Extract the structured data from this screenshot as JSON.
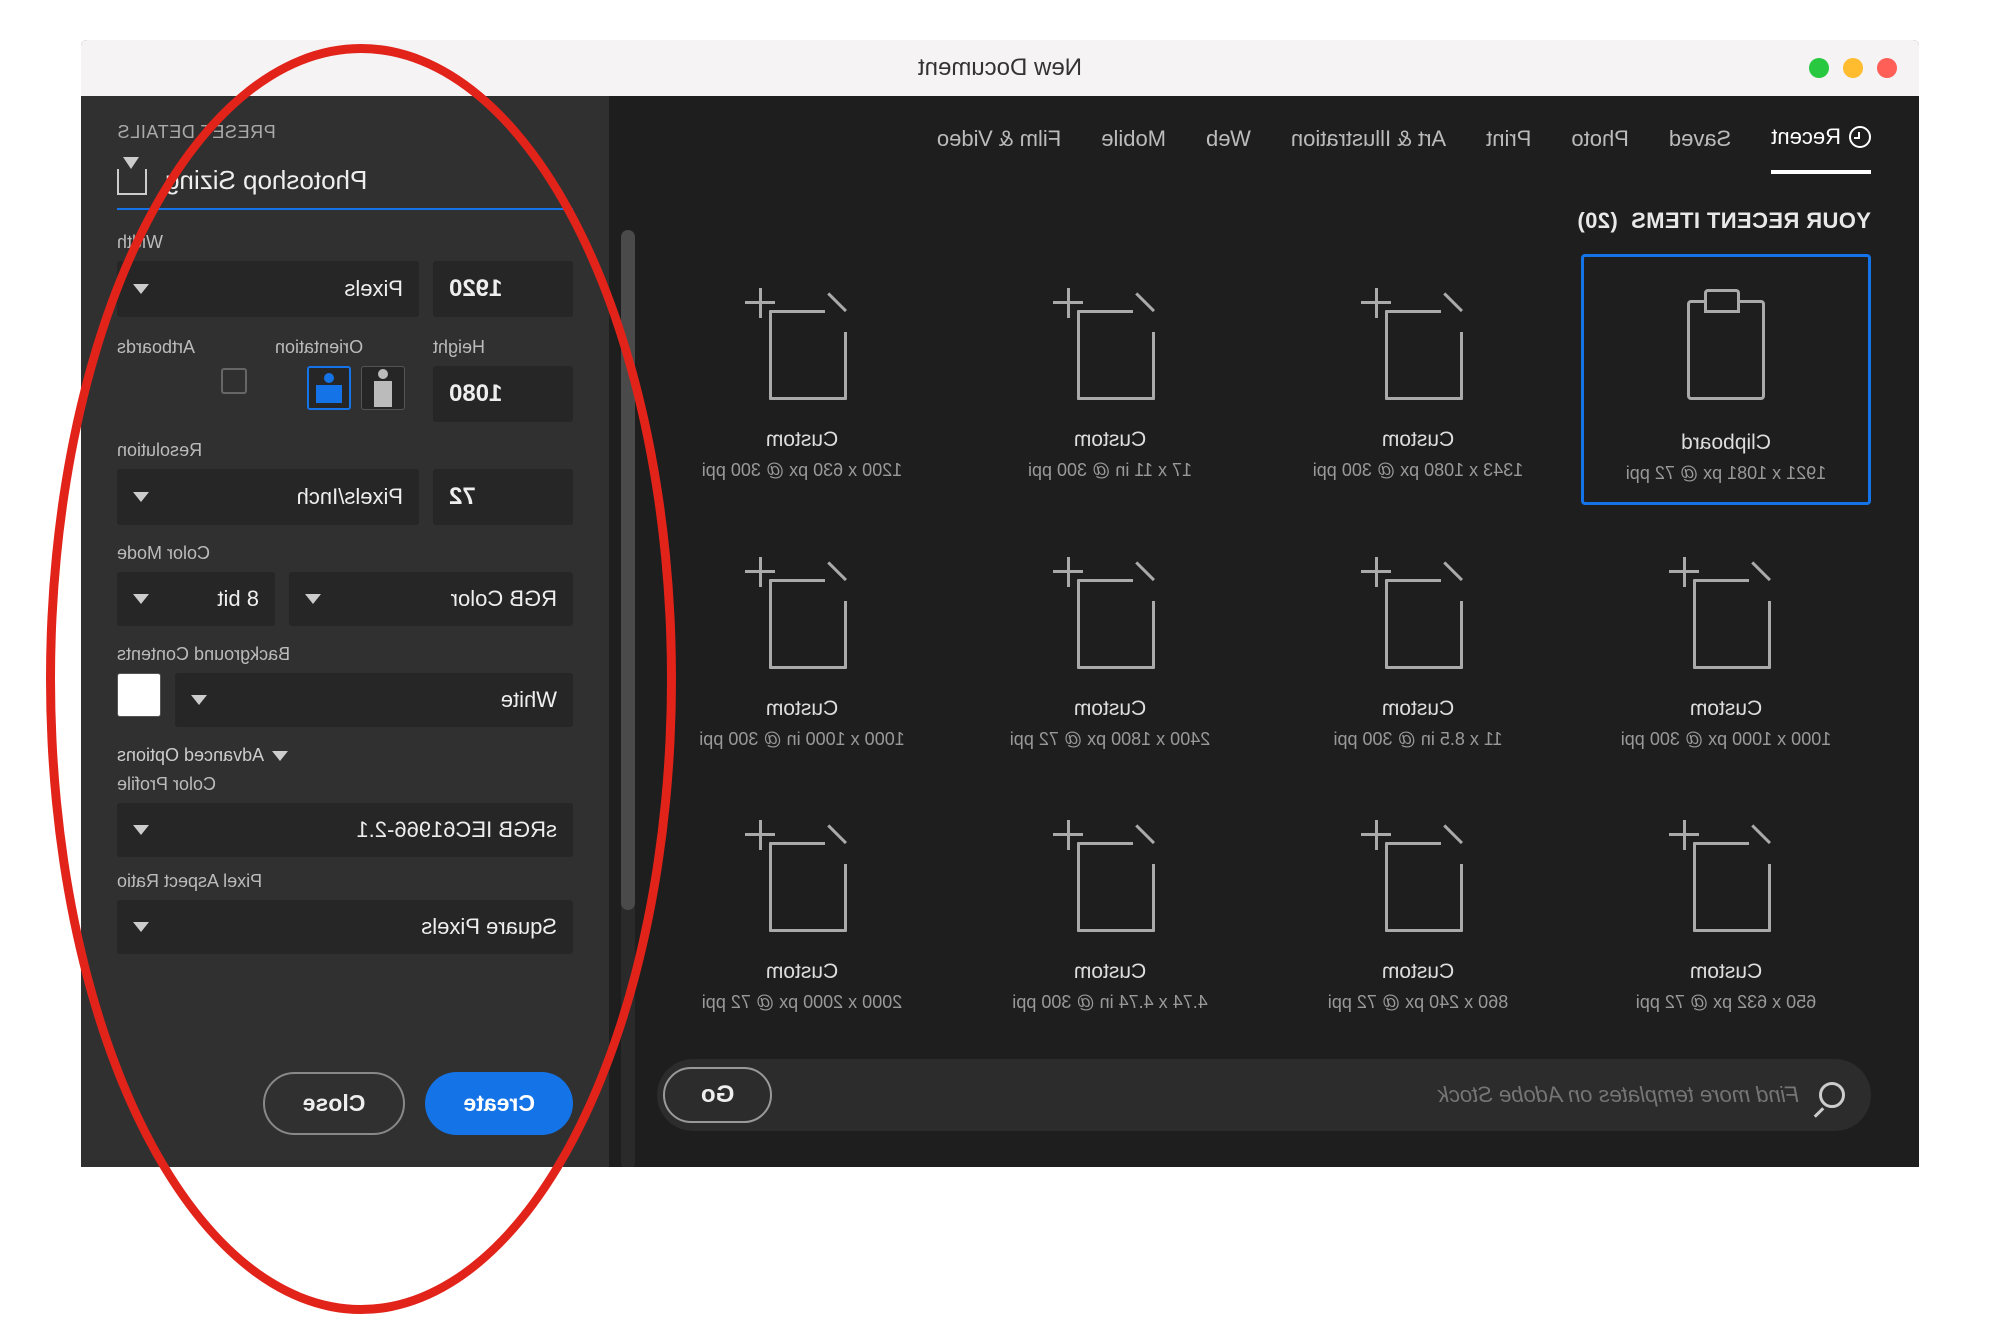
{
  "window_title": "New Document",
  "tabs": [
    "Recent",
    "Saved",
    "Photo",
    "Print",
    "Art & Illustration",
    "Web",
    "Mobile",
    "Film & Video"
  ],
  "active_tab": 0,
  "recent_header": "YOUR RECENT ITEMS",
  "recent_count": "(20)",
  "cards": [
    {
      "name": "Clipboard",
      "dims": "1921 x 1081 px @ 72 ppi",
      "selected": true,
      "kind": "clipboard"
    },
    {
      "name": "Custom",
      "dims": "1343 x 1080 px @ 300 ppi"
    },
    {
      "name": "Custom",
      "dims": "17 x 11 in @ 300 ppi"
    },
    {
      "name": "Custom",
      "dims": "1200 x 630 px @ 300 ppi"
    },
    {
      "name": "Custom",
      "dims": "1000 x 1000 px @ 300 ppi"
    },
    {
      "name": "Custom",
      "dims": "11 x 8.5 in @ 300 ppi"
    },
    {
      "name": "Custom",
      "dims": "2400 x 1800 px @ 72 ppi"
    },
    {
      "name": "Custom",
      "dims": "1000 x 1000 in @ 300 ppi"
    },
    {
      "name": "Custom",
      "dims": "650 x 632 px @ 72 ppi"
    },
    {
      "name": "Custom",
      "dims": "860 x 240 px @ 72 ppi"
    },
    {
      "name": "Custom",
      "dims": "4.74 x 4.74 in @ 300 ppi"
    },
    {
      "name": "Custom",
      "dims": "2000 x 2000 px @ 72 ppi"
    }
  ],
  "search_placeholder": "Find more templates on Adobe Stock",
  "go_label": "Go",
  "panel": {
    "header": "PRESET DETAILS",
    "preset_name": "Photoshop Sizing",
    "width_label": "Width",
    "width_value": "1920",
    "width_unit": "Pixels",
    "height_label": "Height",
    "height_value": "1080",
    "orientation_label": "Orientation",
    "artboards_label": "Artboards",
    "resolution_label": "Resolution",
    "resolution_value": "72",
    "resolution_unit": "Pixels/Inch",
    "color_mode_label": "Color Mode",
    "color_mode": "RGB Color",
    "bit_depth": "8 bit",
    "background_label": "Background Contents",
    "background": "White",
    "advanced_label": "Advanced Options",
    "color_profile_label": "Color Profile",
    "color_profile": "sRGB IEC61966-2.1",
    "pixel_aspect_label": "Pixel Aspect Ratio",
    "pixel_aspect": "Square Pixels"
  },
  "buttons": {
    "close": "Close",
    "create": "Create"
  }
}
